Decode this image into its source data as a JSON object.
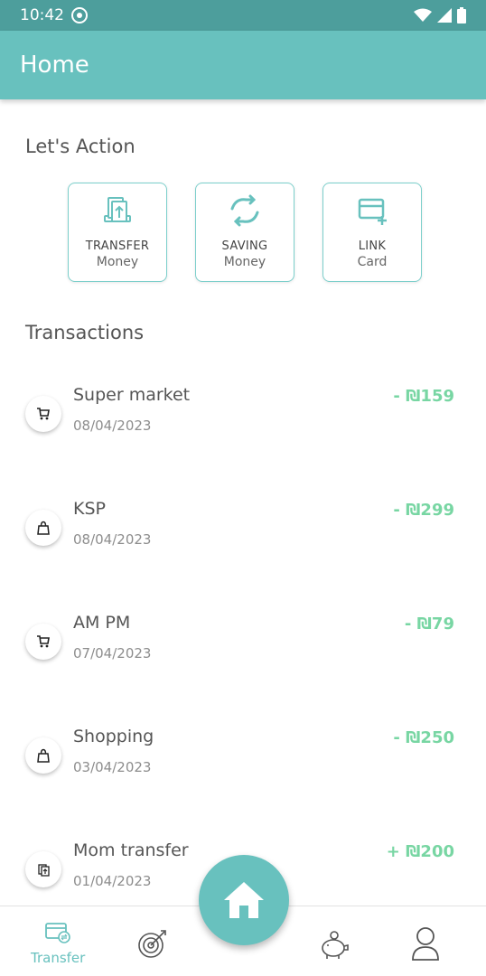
{
  "status_bar": {
    "time": "10:42"
  },
  "app_bar": {
    "title": "Home"
  },
  "actions": {
    "heading": "Let's Action",
    "cards": [
      {
        "line1": "TRANSFER",
        "line2": "Money",
        "icon": "transfer-icon"
      },
      {
        "line1": "SAVING",
        "line2": "Money",
        "icon": "refresh-icon"
      },
      {
        "line1": "LINK",
        "line2": "Card",
        "icon": "card-add-icon"
      }
    ]
  },
  "transactions": {
    "heading": "Transactions",
    "items": [
      {
        "name": "Super market",
        "date": "08/04/2023",
        "amount": "- ₪159",
        "icon": "cart-icon"
      },
      {
        "name": "KSP",
        "date": "08/04/2023",
        "amount": "- ₪299",
        "icon": "bag-icon"
      },
      {
        "name": "AM PM",
        "date": "07/04/2023",
        "amount": "- ₪79",
        "icon": "cart-icon"
      },
      {
        "name": "Shopping",
        "date": "03/04/2023",
        "amount": "- ₪250",
        "icon": "bag-icon"
      },
      {
        "name": "Mom transfer",
        "date": "01/04/2023",
        "amount": "+ ₪200",
        "icon": "transfer-small-icon"
      }
    ]
  },
  "bottom_nav": {
    "transfer_label": "Transfer",
    "items": [
      "transfer-icon",
      "target-icon",
      "home-icon",
      "piggy-bank-icon",
      "user-icon"
    ]
  },
  "colors": {
    "primary": "#68c1be",
    "status_bar": "#4d9e9c",
    "amount_green": "#78d6a3",
    "card_border": "#7ccfcb"
  }
}
